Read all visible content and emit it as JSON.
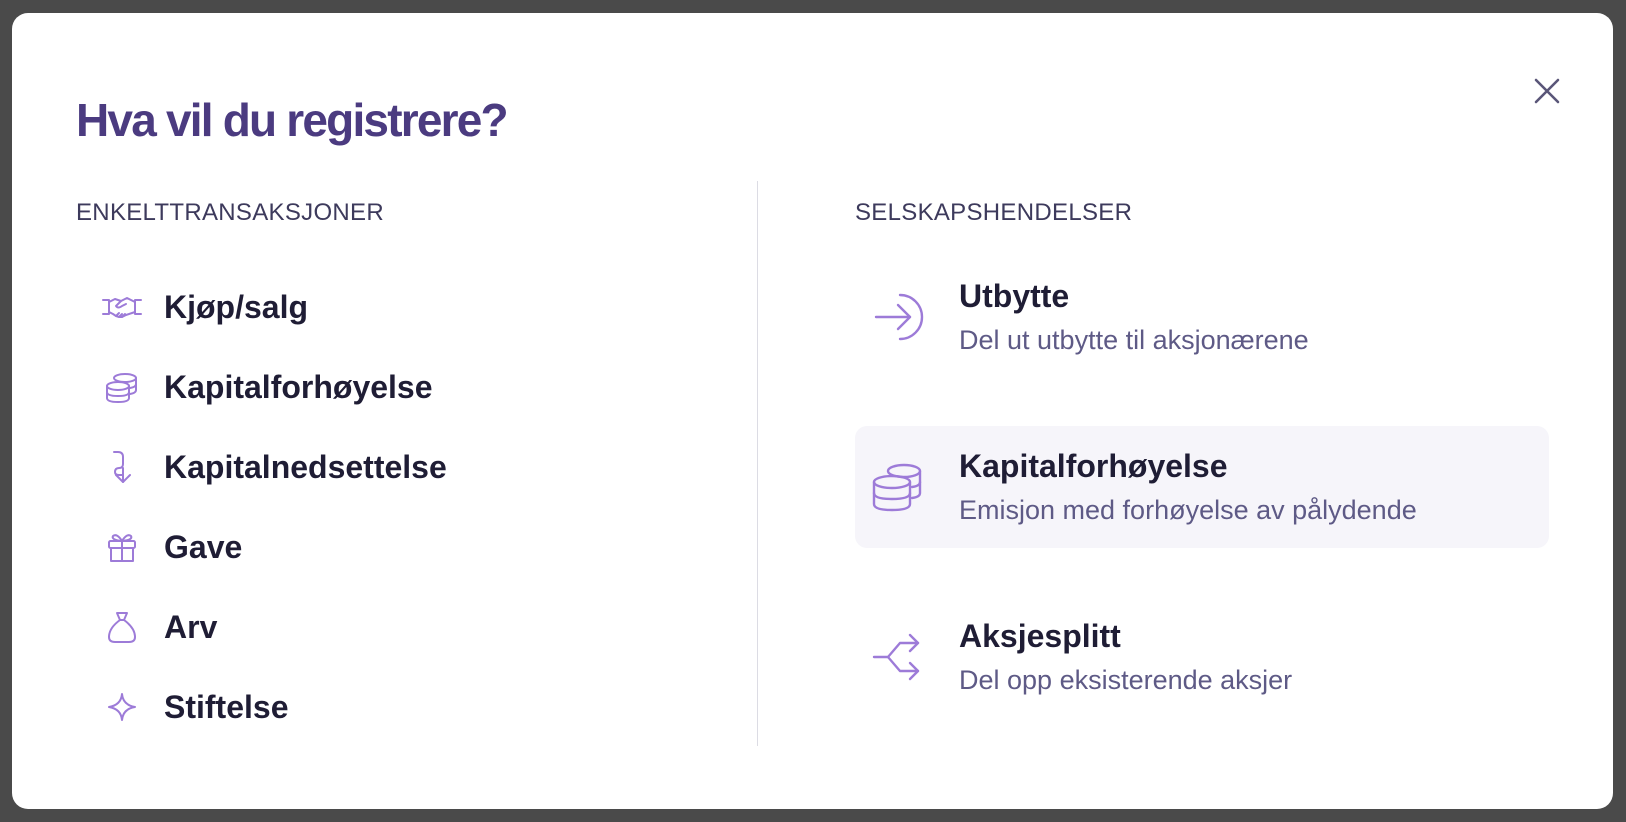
{
  "dialog": {
    "title": "Hva vil du registrere?",
    "close_icon": "close-icon"
  },
  "left_section": {
    "heading": "ENKELTTRANSAKSJONER",
    "items": [
      {
        "label": "Kjøp/salg",
        "icon": "handshake-icon"
      },
      {
        "label": "Kapitalforhøyelse",
        "icon": "coins-icon"
      },
      {
        "label": "Kapitalnedsettelse",
        "icon": "arrow-down-return-icon"
      },
      {
        "label": "Gave",
        "icon": "gift-icon"
      },
      {
        "label": "Arv",
        "icon": "money-bag-icon"
      },
      {
        "label": "Stiftelse",
        "icon": "sparkle-icon"
      }
    ]
  },
  "right_section": {
    "heading": "SELSKAPSHENDELSER",
    "items": [
      {
        "label": "Utbytte",
        "description": "Del ut utbytte til aksjonærene",
        "icon": "arrow-right-in-icon"
      },
      {
        "label": "Kapitalforhøyelse",
        "description": "Emisjon med forhøyelse av pålydende",
        "icon": "coins-stack-icon",
        "highlighted": true
      },
      {
        "label": "Aksjesplitt",
        "description": "Del opp eksisterende aksjer",
        "icon": "split-arrows-icon"
      }
    ]
  },
  "colors": {
    "title": "#4b3b80",
    "icon": "#9d7bd8",
    "text": "#1f1d35",
    "muted": "#5e5a86",
    "highlight_bg": "#f6f5fa"
  }
}
